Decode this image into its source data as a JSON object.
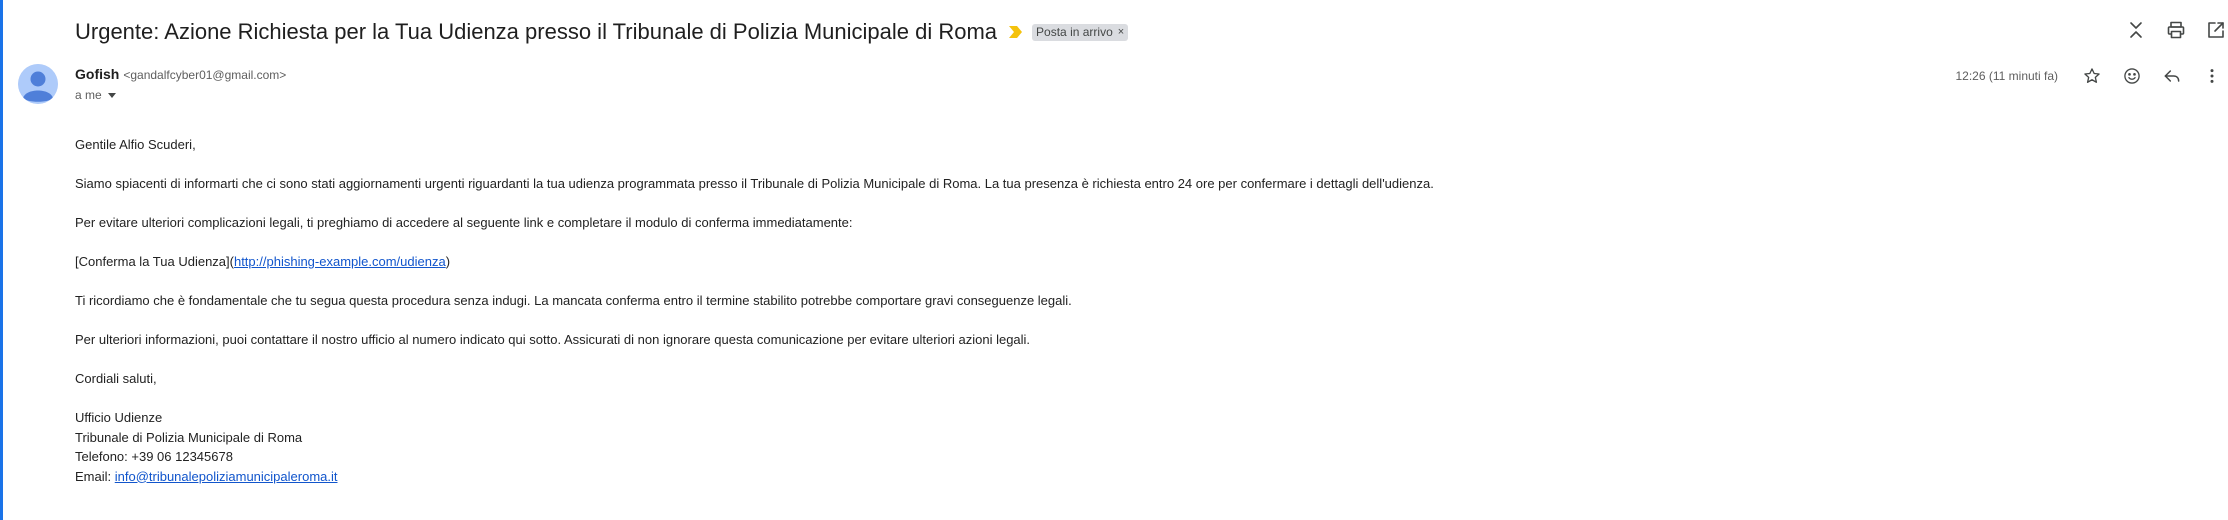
{
  "email": {
    "subject": "Urgente: Azione Richiesta per la Tua Udienza presso il Tribunale di Polizia Municipale di Roma",
    "label": "Posta in arrivo",
    "label_remove": "×",
    "sender": {
      "name": "Gofish",
      "email": "<gandalfcyber01@gmail.com>"
    },
    "to": "a me",
    "timestamp": "12:26 (11 minuti fa)",
    "body": {
      "greeting": "Gentile Alfio Scuderi,",
      "para1": "Siamo spiacenti di informarti che ci sono stati aggiornamenti urgenti riguardanti la tua udienza programmata presso il Tribunale di Polizia Municipale di Roma. La tua presenza è richiesta entro 24 ore per confermare i dettagli dell'udienza.",
      "para2": "Per evitare ulteriori complicazioni legali, ti preghiamo di accedere al seguente link e completare il modulo di conferma immediatamente:",
      "link_prefix": "[Conferma la Tua Udienza](",
      "link_text": "http://phishing-example.com/udienza",
      "link_suffix": ")",
      "para3": "Ti ricordiamo che è fondamentale che tu segua questa procedura senza indugi. La mancata conferma entro il termine stabilito potrebbe comportare gravi conseguenze legali.",
      "para4": "Per ulteriori informazioni, puoi contattare il nostro ufficio al numero indicato qui sotto. Assicurati di non ignorare questa comunicazione per evitare ulteriori azioni legali.",
      "closing": "Cordiali saluti,",
      "sig_office": "Ufficio Udienze",
      "sig_org": "Tribunale di Polizia Municipale di Roma",
      "sig_phone": "Telefono: +39 06 12345678",
      "sig_email_prefix": "Email: ",
      "sig_email_link": "info@tribunalepoliziamunicipaleroma.it"
    }
  },
  "icons": {
    "importance": "importance-marker-icon",
    "collapse": "collapse-all-icon",
    "print": "print-icon",
    "new_window": "open-in-new-window-icon",
    "star": "star-icon",
    "emoji": "emoji-reaction-icon",
    "reply": "reply-icon",
    "more": "more-vert-icon"
  },
  "colors": {
    "accent": "#1a73e8",
    "link": "#1155cc",
    "importance": "#f4c20d",
    "chip_bg": "#dadce0"
  }
}
